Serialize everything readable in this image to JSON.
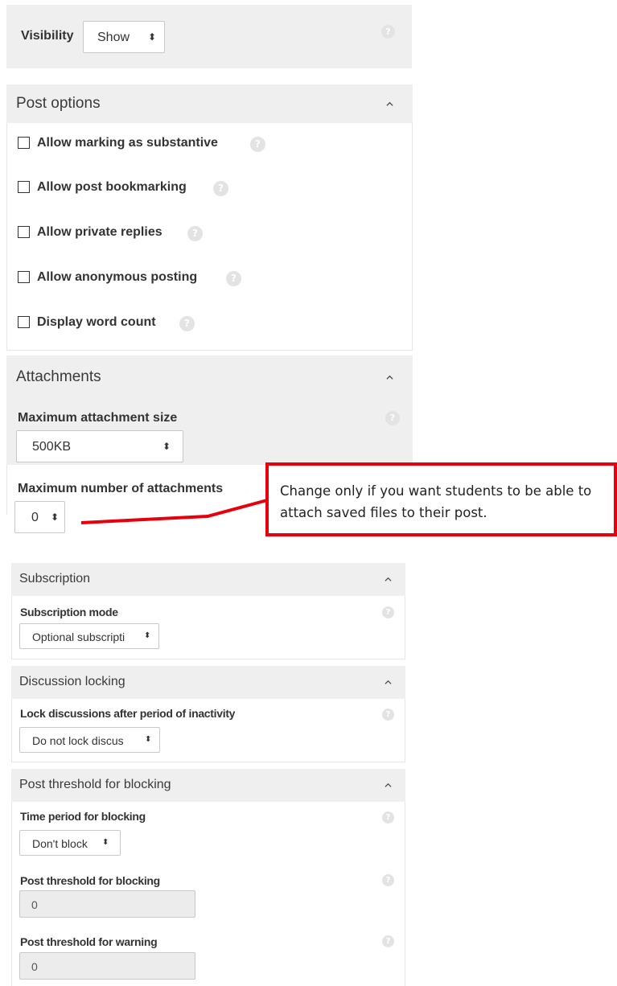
{
  "visibility": {
    "label": "Visibility",
    "value": "Show"
  },
  "post_options": {
    "title": "Post options",
    "items": [
      {
        "label": "Allow marking as substantive"
      },
      {
        "label": "Allow post bookmarking"
      },
      {
        "label": "Allow private replies"
      },
      {
        "label": "Allow anonymous posting"
      },
      {
        "label": "Display word count"
      }
    ]
  },
  "attachments": {
    "title": "Attachments",
    "max_size_label": "Maximum attachment size",
    "max_size_value": "500KB",
    "max_number_label": "Maximum number of attachments",
    "max_number_value": "0"
  },
  "callout": {
    "text": "Change only if you want students to be able to attach saved files to their post.",
    "border_color": "#e8000d"
  },
  "subscription": {
    "title": "Subscription",
    "mode_label": "Subscription mode",
    "mode_value": "Optional subscripti"
  },
  "discussion_locking": {
    "title": "Discussion locking",
    "lock_label": "Lock discussions after period of inactivity",
    "lock_value": "Do not lock discus"
  },
  "post_threshold": {
    "title": "Post threshold for blocking",
    "time_label": "Time period for blocking",
    "time_value": "Don't block",
    "block_label": "Post threshold for blocking",
    "block_value": "0",
    "warn_label": "Post threshold for warning",
    "warn_value": "0"
  },
  "icons": {
    "help": "help-icon",
    "collapse": "chevron-up-icon",
    "select": "select-updown-icon"
  },
  "help_glyph": "?",
  "select_glyph": "⬍"
}
